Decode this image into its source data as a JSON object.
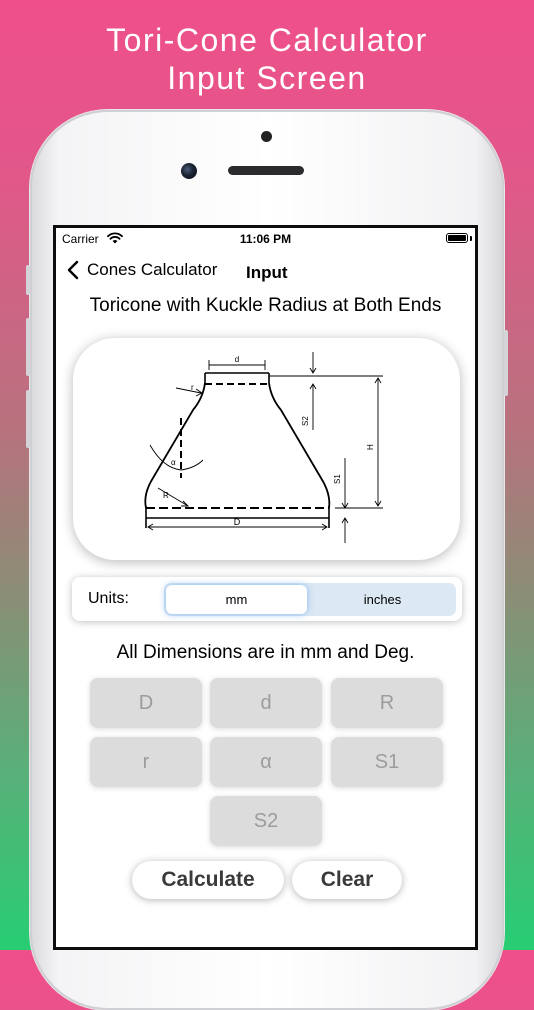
{
  "promo": {
    "title_line1": "Tori-Cone Calculator",
    "title_line2": "Input Screen"
  },
  "status_bar": {
    "carrier": "Carrier",
    "time": "11:06 PM"
  },
  "nav": {
    "back_label": "Cones Calculator",
    "title": "Input"
  },
  "headline": "Toricone with Kuckle Radius at Both Ends",
  "diagram": {
    "labels": {
      "d": "d",
      "r": "r",
      "alpha": "α",
      "R": "R",
      "D": "D",
      "H": "H",
      "S1": "S1",
      "S2": "S2"
    }
  },
  "units": {
    "label": "Units:",
    "options": [
      "mm",
      "inches"
    ],
    "selected": "mm"
  },
  "dims_note": "All Dimensions are in mm and Deg.",
  "fields": [
    {
      "placeholder": "D"
    },
    {
      "placeholder": "d"
    },
    {
      "placeholder": "R"
    },
    {
      "placeholder": "r"
    },
    {
      "placeholder": "α"
    },
    {
      "placeholder": "S1"
    },
    {
      "placeholder": "S2"
    }
  ],
  "buttons": {
    "calculate": "Calculate",
    "clear": "Clear"
  },
  "colors": {
    "gradient_top": "#ef4f8a",
    "gradient_bottom": "#27cd73",
    "field_bg": "#dcdcdc",
    "segment_bg": "#dce8f3"
  },
  "icons": [
    "wifi-icon",
    "battery-icon",
    "chevron-left-icon"
  ]
}
